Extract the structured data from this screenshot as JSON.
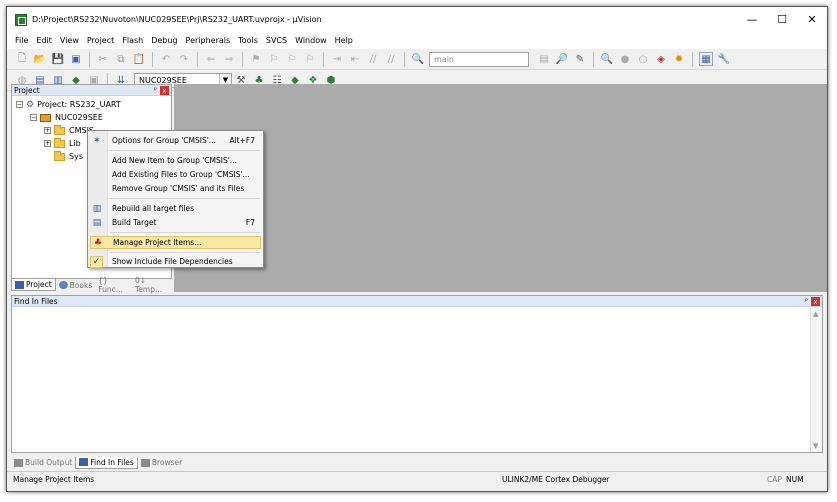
{
  "window": {
    "title": "D:\\Project\\RS232\\Nuvoton\\NUC029SEE\\Prj\\RS232_UART.uvprojx - µVision",
    "min": "—",
    "max": "☐",
    "close": "✕"
  },
  "menu": [
    "File",
    "Edit",
    "View",
    "Project",
    "Flash",
    "Debug",
    "Peripherals",
    "Tools",
    "SVCS",
    "Window",
    "Help"
  ],
  "toolbar": {
    "find_combo": "main",
    "target_combo": "NUC029SEE"
  },
  "project_panel": {
    "title": "Project",
    "pin": "ᵖ",
    "close": "x",
    "tree": {
      "root": "Project: RS232_UART",
      "target": "NUC029SEE",
      "groups": [
        "CMSIS",
        "Lib",
        "Sys"
      ]
    },
    "tabs": [
      "Project",
      "Books",
      "{} Func...",
      "0↓ Temp..."
    ]
  },
  "context_menu": {
    "items": [
      {
        "label": "Options for Group 'CMSIS'...",
        "shortcut": "Alt+F7"
      },
      {
        "label": "Add New  Item to Group 'CMSIS'..."
      },
      {
        "label": "Add Existing Files to Group 'CMSIS'..."
      },
      {
        "label": "Remove Group 'CMSIS' and its Files"
      },
      {
        "label": "Rebuild all target files"
      },
      {
        "label": "Build Target",
        "shortcut": "F7"
      },
      {
        "label": "Manage Project Items..."
      },
      {
        "label": "Show Include File Dependencies"
      }
    ]
  },
  "find_panel": {
    "title": "Find In Files",
    "pin": "ᵖ",
    "close": "x"
  },
  "output_tabs": [
    "Build Output",
    "Find In Files",
    "Browser"
  ],
  "status": {
    "left": "Manage Project Items",
    "debugger": "ULINK2/ME Cortex Debugger",
    "cap": "CAP",
    "num": "NUM"
  }
}
